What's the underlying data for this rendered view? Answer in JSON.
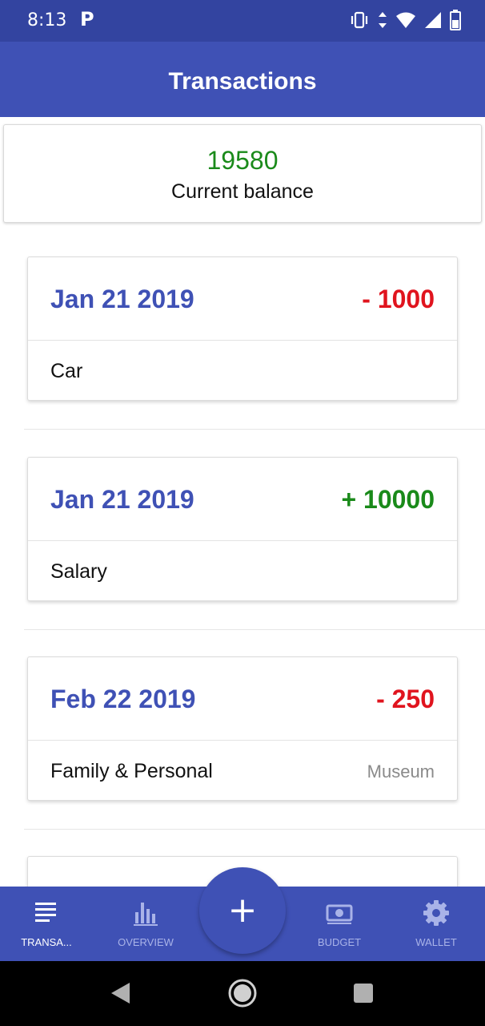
{
  "status_bar": {
    "time": "8:13",
    "notification_letter": "P",
    "icons": [
      "vibrate-icon",
      "data-arrows-icon",
      "wifi-icon",
      "signal-icon",
      "battery-icon"
    ]
  },
  "app_bar": {
    "title": "Transactions"
  },
  "balance": {
    "amount": "19580",
    "label": "Current balance"
  },
  "transactions": [
    {
      "date": "Jan 21 2019",
      "amount": "- 1000",
      "type": "expense",
      "category": "Car",
      "note": ""
    },
    {
      "date": "Jan 21 2019",
      "amount": "+ 10000",
      "type": "income",
      "category": "Salary",
      "note": ""
    },
    {
      "date": "Feb 22 2019",
      "amount": "- 250",
      "type": "expense",
      "category": "Family & Personal",
      "note": "Museum"
    }
  ],
  "bottom_nav": {
    "items": [
      {
        "label": "TRANSA...",
        "icon": "list-icon",
        "active": true
      },
      {
        "label": "OVERVIEW",
        "icon": "bar-chart-icon",
        "active": false
      },
      {
        "label": "BUDGET",
        "icon": "money-icon",
        "active": false
      },
      {
        "label": "WALLET",
        "icon": "gear-icon",
        "active": false
      }
    ],
    "fab": {
      "glyph": "+",
      "icon": "plus-icon"
    }
  },
  "system_nav": {
    "icons": [
      "back-icon",
      "home-icon",
      "recents-icon"
    ]
  },
  "colors": {
    "primary": "#3f51b5",
    "status_bar": "#3344a0",
    "income": "#1a8a1a",
    "expense": "#e0141e",
    "note": "#8a8a8a"
  }
}
